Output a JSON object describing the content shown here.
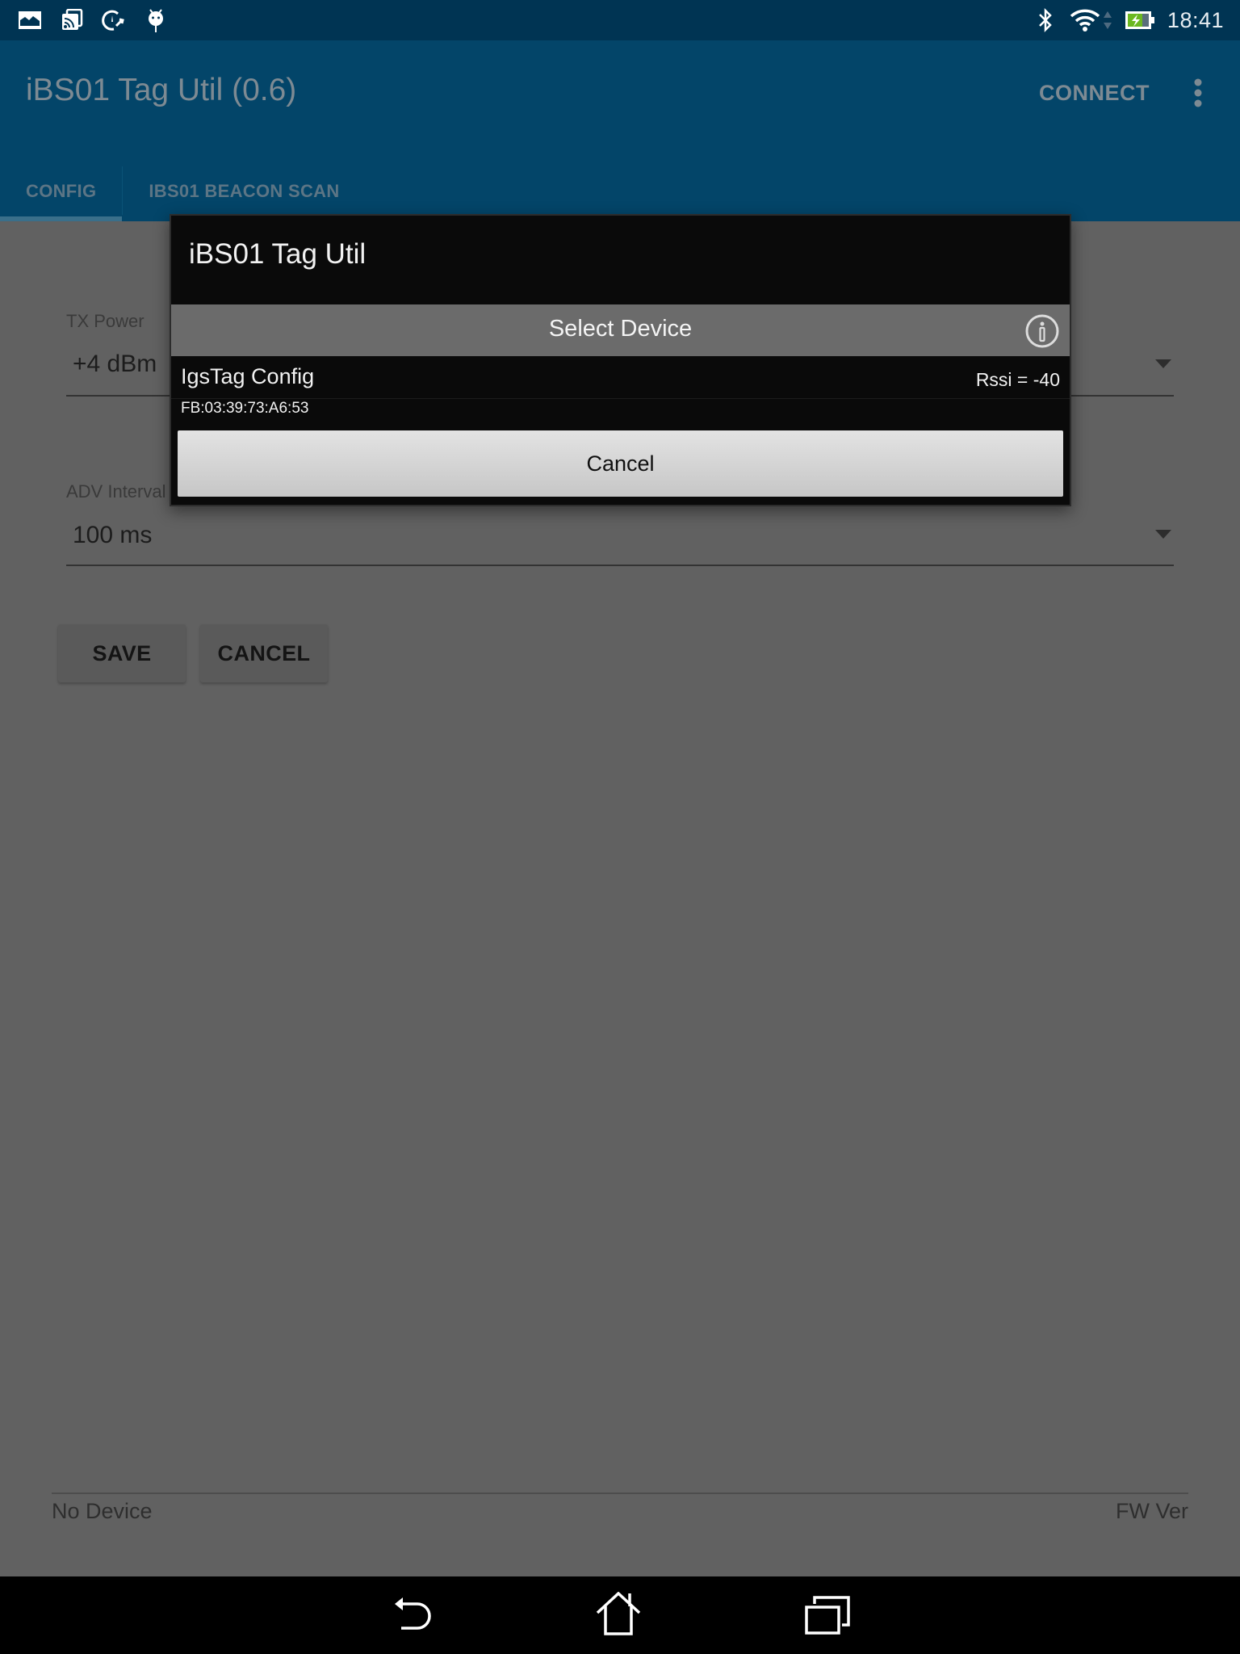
{
  "status_bar": {
    "left_icons": [
      "gallery-icon",
      "cast-icon",
      "speed-wrench-icon",
      "android-debug-icon"
    ],
    "right_icons": [
      "bluetooth-icon",
      "wifi-icon",
      "data-arrows-icon",
      "battery-charging-icon"
    ],
    "time": "18:41",
    "battery_color": "#6bb820"
  },
  "app_bar": {
    "title": "iBS01 Tag Util (0.6)",
    "connect_label": "CONNECT",
    "overflow_icon": "more-vert-icon",
    "color": "#034569"
  },
  "tabs": [
    {
      "label": "CONFIG",
      "active": true
    },
    {
      "label": "IBS01 BEACON SCAN",
      "active": false
    }
  ],
  "form": {
    "tx_power": {
      "label": "TX Power",
      "value": "+4 dBm"
    },
    "adv_interval": {
      "label": "ADV Interval",
      "value": "100 ms"
    },
    "save_label": "SAVE",
    "cancel_label": "CANCEL"
  },
  "footer": {
    "device_status": "No Device",
    "fw_version_label": "FW Ver"
  },
  "dialog": {
    "title": "iBS01 Tag Util",
    "header": "Select Device",
    "info_icon": "info-icon",
    "devices": [
      {
        "name": "IgsTag Config",
        "mac": "FB:03:39:73:A6:53",
        "rssi": "Rssi = -40"
      }
    ],
    "cancel_label": "Cancel"
  },
  "nav_bar": {
    "buttons": [
      "back-icon",
      "home-icon",
      "recents-icon"
    ]
  }
}
